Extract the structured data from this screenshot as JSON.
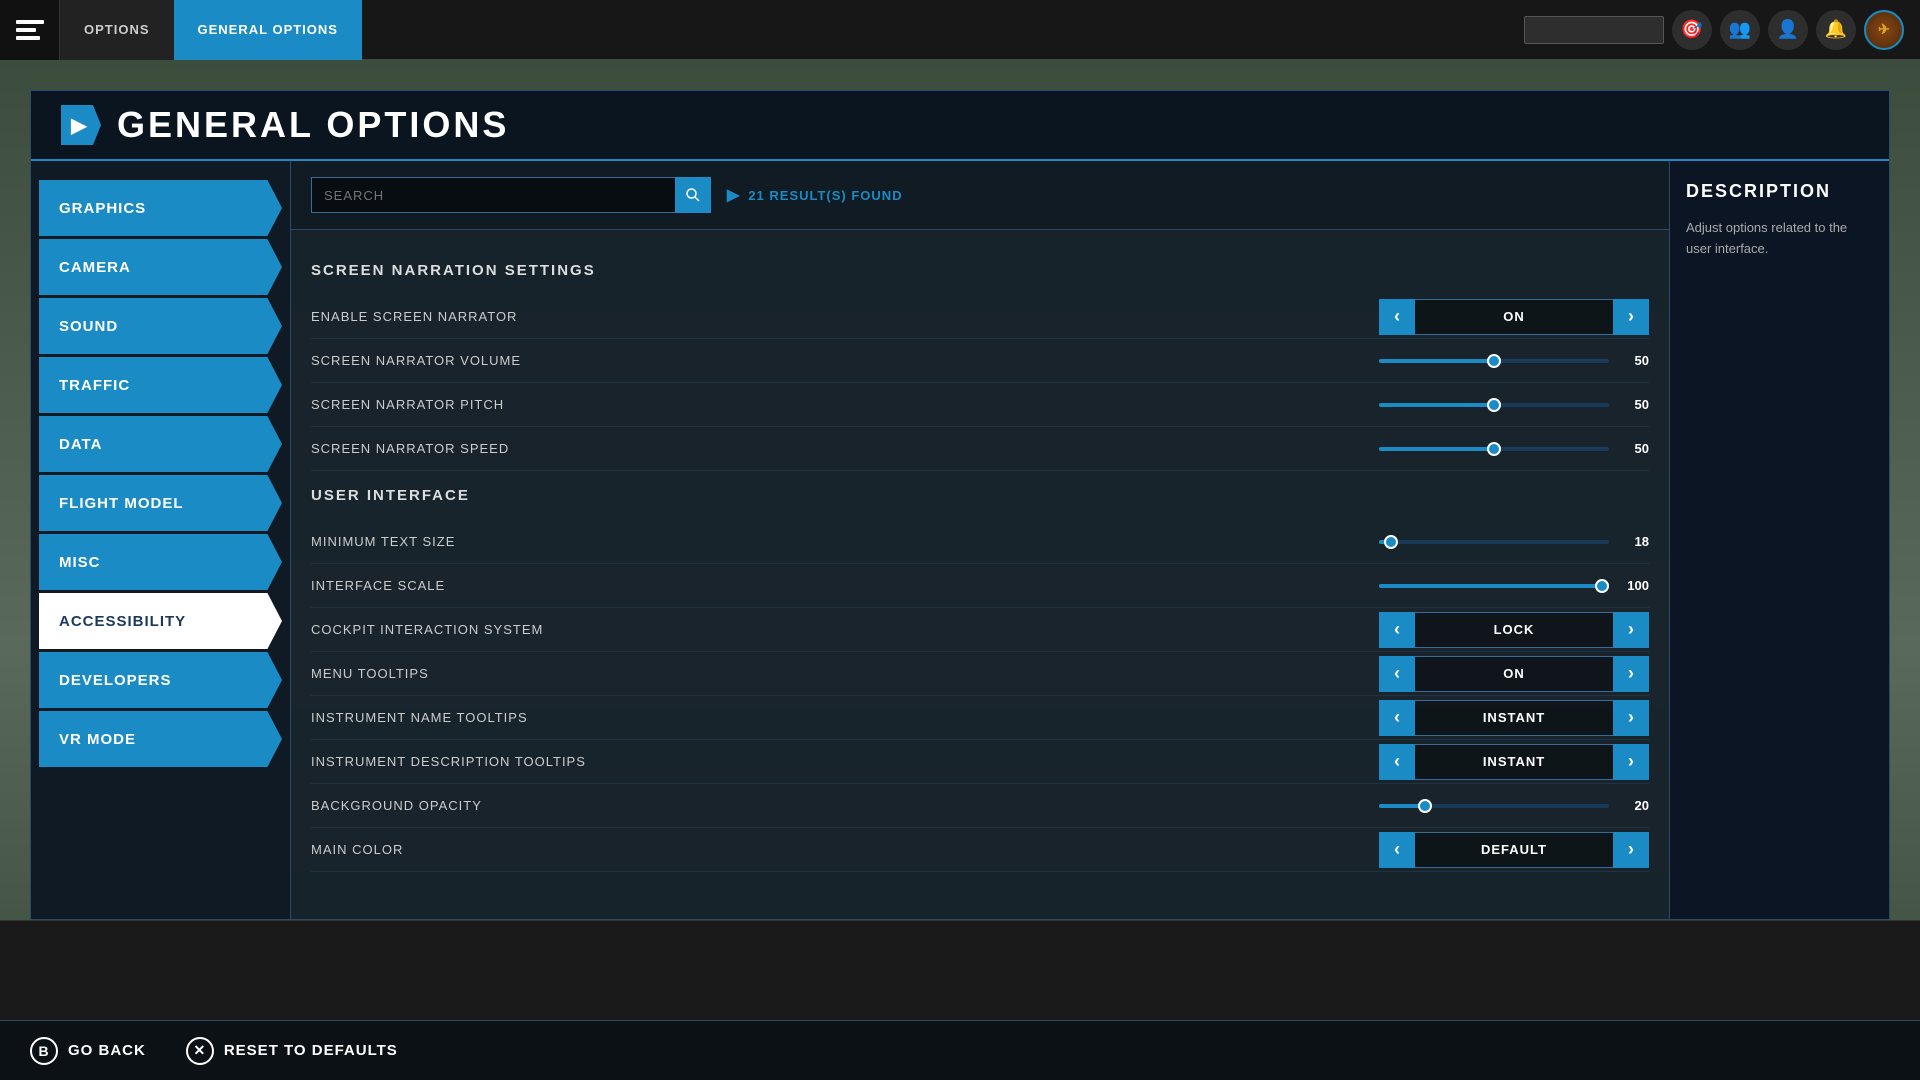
{
  "topbar": {
    "tab_options": "OPTIONS",
    "tab_general": "GENERAL OPTIONS",
    "search_placeholder": ""
  },
  "page": {
    "title": "GENERAL OPTIONS",
    "icon_char": "▶"
  },
  "sidebar": {
    "items": [
      {
        "id": "graphics",
        "label": "GRAPHICS",
        "active": false
      },
      {
        "id": "camera",
        "label": "CAMERA",
        "active": false
      },
      {
        "id": "sound",
        "label": "SOUND",
        "active": false
      },
      {
        "id": "traffic",
        "label": "TRAFFIC",
        "active": false
      },
      {
        "id": "data",
        "label": "DATA",
        "active": false
      },
      {
        "id": "flight-model",
        "label": "FLIGHT MODEL",
        "active": false
      },
      {
        "id": "misc",
        "label": "MISC",
        "active": false
      },
      {
        "id": "accessibility",
        "label": "ACCESSIBILITY",
        "active": true
      },
      {
        "id": "developers",
        "label": "DEVELOPERS",
        "active": false
      },
      {
        "id": "vr-mode",
        "label": "VR MODE",
        "active": false
      }
    ]
  },
  "search": {
    "placeholder": "SEARCH",
    "results_text": "21 RESULT(S) FOUND"
  },
  "sections": [
    {
      "id": "screen-narration",
      "header": "SCREEN NARRATION SETTINGS",
      "settings": [
        {
          "id": "enable-screen-narrator",
          "label": "ENABLE SCREEN NARRATOR",
          "type": "toggle",
          "value": "ON"
        },
        {
          "id": "screen-narrator-volume",
          "label": "SCREEN NARRATOR VOLUME",
          "type": "slider",
          "value": 50,
          "percent": 50
        },
        {
          "id": "screen-narrator-pitch",
          "label": "SCREEN NARRATOR PITCH",
          "type": "slider",
          "value": 50,
          "percent": 50
        },
        {
          "id": "screen-narrator-speed",
          "label": "SCREEN NARRATOR SPEED",
          "type": "slider",
          "value": 50,
          "percent": 50
        }
      ]
    },
    {
      "id": "user-interface",
      "header": "USER INTERFACE",
      "settings": [
        {
          "id": "minimum-text-size",
          "label": "MINIMUM TEXT SIZE",
          "type": "slider",
          "value": 18,
          "percent": 5
        },
        {
          "id": "interface-scale",
          "label": "INTERFACE SCALE",
          "type": "slider",
          "value": 100,
          "percent": 100
        },
        {
          "id": "cockpit-interaction",
          "label": "COCKPIT INTERACTION SYSTEM",
          "type": "toggle",
          "value": "LOCK"
        },
        {
          "id": "menu-tooltips",
          "label": "MENU TOOLTIPS",
          "type": "toggle",
          "value": "ON"
        },
        {
          "id": "instrument-name-tooltips",
          "label": "INSTRUMENT NAME TOOLTIPS",
          "type": "toggle",
          "value": "INSTANT"
        },
        {
          "id": "instrument-description-tooltips",
          "label": "INSTRUMENT DESCRIPTION TOOLTIPS",
          "type": "toggle",
          "value": "INSTANT"
        },
        {
          "id": "background-opacity",
          "label": "BACKGROUND OPACITY",
          "type": "slider",
          "value": 20,
          "percent": 20
        },
        {
          "id": "main-color",
          "label": "MAIN COLOR",
          "type": "toggle",
          "value": "DEFAULT"
        }
      ]
    }
  ],
  "description": {
    "title": "DESCRIPTION",
    "text": "Adjust options related to the user interface."
  },
  "bottom_bar": {
    "go_back_label": "GO BACK",
    "go_back_icon": "B",
    "reset_label": "RESET TO DEFAULTS",
    "reset_icon": "✕"
  }
}
